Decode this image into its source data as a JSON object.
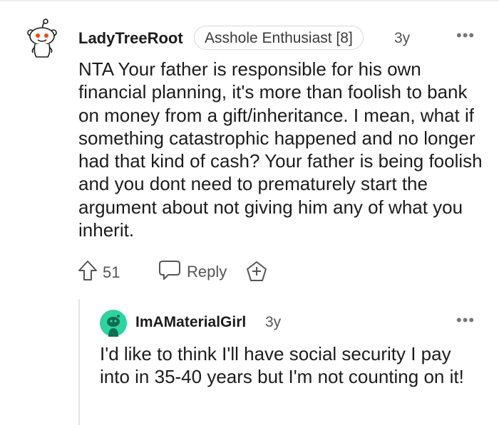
{
  "comment": {
    "author": "LadyTreeRoot",
    "flair": "Asshole Enthusiast [8]",
    "age": "3y",
    "more": "•••",
    "body": "NTA Your father is responsible for his own financial planning, it's more than foolish to bank on money from a gift/inheritance. I mean, what if something catastrophic happened and no longer had that kind of cash? Your father is being foolish and you dont need to prematurely start the argument about not giving him any of what you inherit.",
    "votes": "51",
    "reply_label": "Reply",
    "icons": {
      "avatar": "snoo-avatar-icon",
      "upvote": "upvote-arrow-icon",
      "reply": "speech-bubble-icon",
      "award": "award-plus-icon"
    }
  },
  "reply": {
    "author": "ImAMaterialGirl",
    "age": "3y",
    "more": "•••",
    "body": "I'd like to think I'll have social security I pay into in 35-40 years but I'm not counting on it!",
    "icons": {
      "avatar": "snoo-avatar-icon"
    }
  },
  "colors": {
    "text": "#1c1c1c",
    "muted": "#555555",
    "border": "#d6d9dc",
    "thread_line": "#e2e4e6",
    "reply_avatar_bg": "#2fd3a0"
  }
}
